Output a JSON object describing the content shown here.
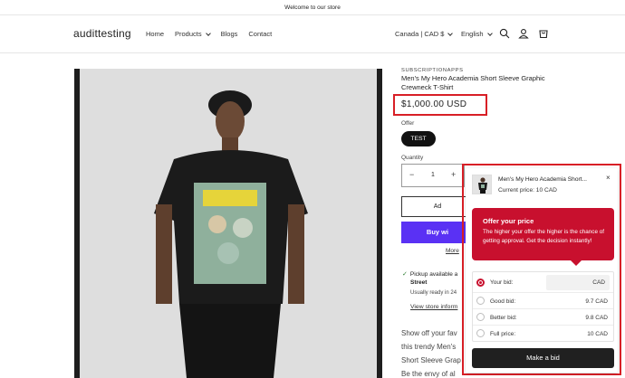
{
  "announcement": "Welcome to our store",
  "header": {
    "logo": "audittesting",
    "nav": [
      "Home",
      "Products",
      "Blogs",
      "Contact"
    ],
    "locale": "Canada | CAD $",
    "language": "English"
  },
  "product": {
    "vendor": "SUBSCRIPTIONAPPS",
    "title": "Men's My Hero Academia Short Sleeve Graphic Crewneck T-Shirt",
    "price": "$1,000.00 USD",
    "option_label": "Offer",
    "option_value": "TEST",
    "quantity_label": "Quantity",
    "quantity_value": "1",
    "add_to_cart": "Ad",
    "buy_now": "Buy wi",
    "more_options": "More",
    "pickup": "Pickup available a",
    "pickup_location": "Street",
    "ready": "Usually ready in 24",
    "view_store": "View store inform",
    "description": [
      "Show off your fav",
      "this trendy Men's",
      "Short Sleeve Grap",
      "Be the envy of al"
    ]
  },
  "widget": {
    "product_title": "Men's My Hero Academia Short...",
    "current_price": "Current price: 10 CAD",
    "close": "×",
    "offer_title": "Offer your price",
    "offer_body": "The higher your offer the higher is the chance of getting approval. Get the decision instantly!",
    "your_bid_label": "Your bid:",
    "your_bid_currency": "CAD",
    "rows": [
      {
        "label": "Good bid:",
        "value": "9.7 CAD"
      },
      {
        "label": "Better bid:",
        "value": "9.8 CAD"
      },
      {
        "label": "Full price:",
        "value": "10 CAD"
      }
    ],
    "make_bid": "Make a bid"
  },
  "colors": {
    "highlight": "#d81f26",
    "offer_red": "#c8102e",
    "buy_purple": "#5a31f4"
  }
}
